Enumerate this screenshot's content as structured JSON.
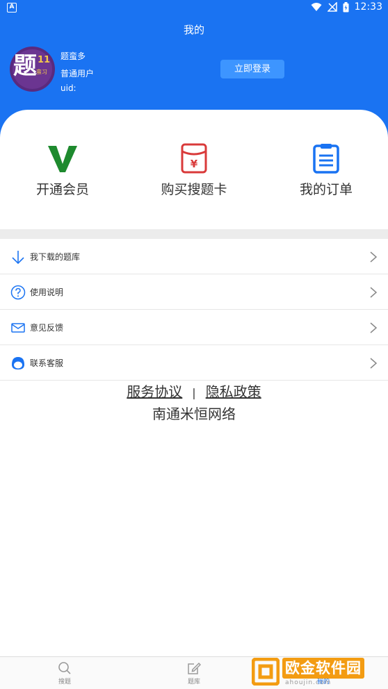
{
  "status_bar": {
    "time": "12:33",
    "app_badge": "A"
  },
  "header": {
    "title": "我的",
    "user": {
      "name": "题蛮多",
      "level": "普通用户",
      "uid_label": "uid:"
    },
    "avatar": {
      "char": "题",
      "num": "11",
      "sub": "蛮习"
    },
    "login_button": "立即登录"
  },
  "features": [
    {
      "label": "开通会员",
      "icon": "vip-v-icon",
      "color": "#1e8a2e"
    },
    {
      "label": "购买搜题卡",
      "icon": "yuan-card-icon",
      "color": "#d93a3a"
    },
    {
      "label": "我的订单",
      "icon": "order-list-icon",
      "color": "#1a73f2"
    }
  ],
  "menu": [
    {
      "label": "我下载的题库",
      "icon": "download-icon"
    },
    {
      "label": "使用说明",
      "icon": "help-icon"
    },
    {
      "label": "意见反馈",
      "icon": "mail-icon"
    },
    {
      "label": "联系客服",
      "icon": "customer-service-icon"
    }
  ],
  "links": {
    "service": "服务协议",
    "separator": "|",
    "privacy": "隐私政策"
  },
  "company": "南通米恒网络",
  "tabbar": [
    {
      "label": "搜题",
      "icon": "search-icon"
    },
    {
      "label": "题库",
      "icon": "edit-icon"
    },
    {
      "label": "我的",
      "icon": "user-icon"
    }
  ],
  "watermark": {
    "text": "欧金软件园",
    "url": "ahoujin.com"
  },
  "colors": {
    "primary": "#1a73f2",
    "login_button": "#3d95ff",
    "vip": "#1e8a2e",
    "card": "#d93a3a"
  }
}
